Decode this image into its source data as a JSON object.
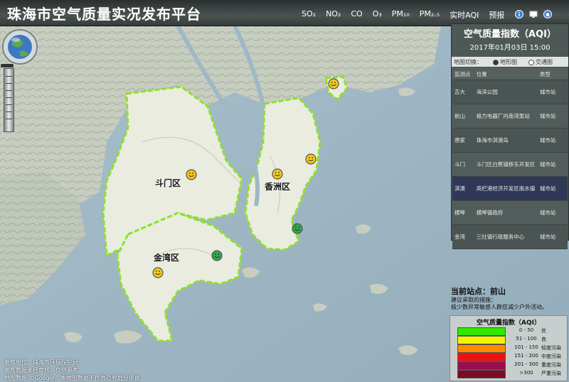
{
  "header": {
    "title": "珠海市空气质量实况发布平台",
    "nav": [
      "SO₂",
      "NO₂",
      "CO",
      "O₃",
      "PM₁₀",
      "PM₂.₅",
      "实时AQI",
      "预报"
    ],
    "icons": [
      "info-icon",
      "screen-icon",
      "home-icon"
    ]
  },
  "map": {
    "districts": [
      "斗门区",
      "香洲区",
      "金湾区"
    ],
    "station_markers": [
      {
        "name": "斗门",
        "color": "#f2c81a"
      },
      {
        "name": "唐家",
        "color": "#f2c81a"
      },
      {
        "name": "前山",
        "color": "#f2c81a"
      },
      {
        "name": "吉大",
        "color": "#2fa84a"
      },
      {
        "name": "金湾",
        "color": "#2fa84a"
      },
      {
        "name": "横琴",
        "color": "#f2c81a"
      },
      {
        "name": "淇澳",
        "color": "#f2c81a"
      }
    ]
  },
  "aqi_panel": {
    "title": "空气质量指数（AQI）",
    "time": "2017年01月03日 15:00",
    "switch_label": "地图切换：",
    "switch_options": [
      "地形图",
      "交通图"
    ],
    "selected_switch": "地形图",
    "columns": [
      "监测点",
      "位置",
      "类型"
    ],
    "stations": [
      {
        "name": "吉大",
        "location": "海滨公园",
        "type": "城市站"
      },
      {
        "name": "前山",
        "location": "格力电器厂内南湾泵站",
        "type": "城市站"
      },
      {
        "name": "唐家",
        "location": "珠海市淇澳岛",
        "type": "城市站"
      },
      {
        "name": "斗门",
        "location": "斗门区白蕉镇移东开发区",
        "type": "城市站"
      },
      {
        "name": "淇澳",
        "location": "高栏港经济开发区南水镇",
        "type": "城市站"
      },
      {
        "name": "横琴",
        "location": "横琴镇政府",
        "type": "城市站"
      },
      {
        "name": "金湾",
        "location": "三灶镇行政服务中心",
        "type": "城市站"
      }
    ],
    "selected_station": "淇澳"
  },
  "current": {
    "station_text": "当前站点：前山",
    "advice_label": "建议采取的措施：",
    "advice": "极少数异常敏感人群应减少户外活动。"
  },
  "legend": {
    "title": "空气质量指数（AQI）",
    "items": [
      {
        "range": "0 - 50",
        "name": "优",
        "color": "#33e600"
      },
      {
        "range": "51 - 100",
        "name": "良",
        "color": "#f5f500"
      },
      {
        "range": "101 - 150",
        "name": "轻度污染",
        "color": "#ff8a00"
      },
      {
        "range": "151 - 200",
        "name": "中度污染",
        "color": "#ee1111"
      },
      {
        "range": "201 - 300",
        "name": "重度污染",
        "color": "#9a0d4c"
      },
      {
        "range": ">300",
        "name": "严重污染",
        "color": "#7a0b24"
      }
    ]
  },
  "footer": {
    "lines": [
      "发布单位：珠海市环境保护局",
      "发布数据未经审核，仅供参考",
      "地图数据 ©Google，本地图数据不作为边界划分依据"
    ]
  }
}
